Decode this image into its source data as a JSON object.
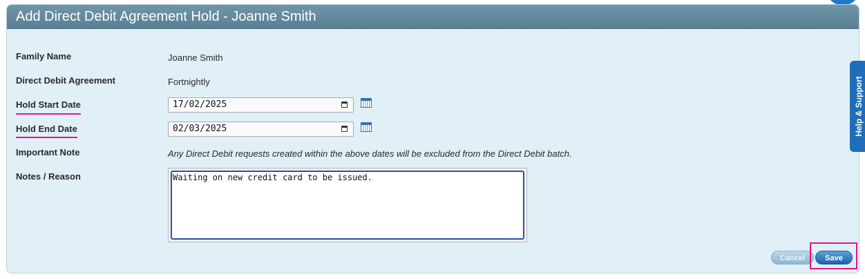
{
  "header": {
    "title": "Add Direct Debit Agreement Hold - Joanne Smith"
  },
  "fields": {
    "family_name": {
      "label": "Family Name",
      "value": "Joanne Smith"
    },
    "agreement": {
      "label": "Direct Debit Agreement",
      "value": "Fortnightly"
    },
    "hold_start": {
      "label": "Hold Start Date",
      "value": "17/02/2025"
    },
    "hold_end": {
      "label": "Hold End Date",
      "value": "02/03/2025"
    },
    "important_note": {
      "label": "Important Note",
      "value": "Any Direct Debit requests created within the above dates will be excluded from the Direct Debit batch."
    },
    "notes": {
      "label": "Notes / Reason",
      "value": "Waiting on new credit card to be issued."
    }
  },
  "help_tab": {
    "label": "Help & Support"
  },
  "buttons": {
    "cancel": "Cancel",
    "save": "Save"
  },
  "colors": {
    "header": "#5f8699",
    "panel": "#e1eff7",
    "highlight": "#e4148a",
    "accent": "#1f6fb8"
  },
  "icons": {
    "calendar": "calendar-icon"
  }
}
